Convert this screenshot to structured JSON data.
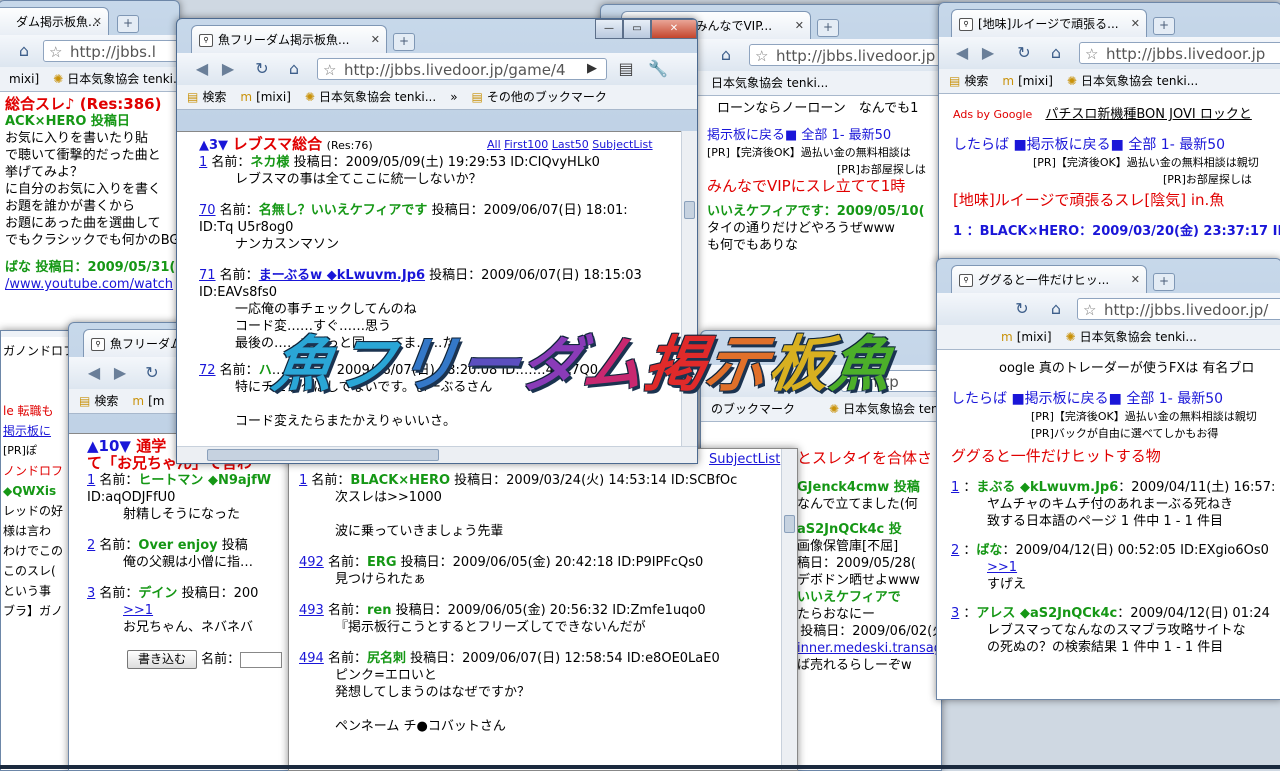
{
  "desktop": {
    "logo_text": "魚フリーダム掲示板魚"
  },
  "win_a": {
    "tab_title": "ダム掲示板魚...",
    "url": "http://jbbs.l",
    "bookmarks": [
      "mixi]",
      "日本気象協会 tenki..."
    ],
    "lines": [
      "総合スレ♪ (Res:386)",
      "ACK×HERO 投稿日",
      "お気に入りを書いたり貼",
      "で聴いて衝撃的だった曲と",
      "挙げてみよ？",
      "に自分のお気に入りを書く",
      "お題を誰かが書くから",
      "お題にあった曲を選曲して",
      "でもクラシックでも何かのBG",
      "ばな 投稿日：2009/05/31(",
      "/www.youtube.com/watch"
    ]
  },
  "win_b": {
    "tab_title": "魚フリーダム掲示板魚...",
    "url": "http://jbbs.livedoor.jp/game/4",
    "bookmarks": [
      "検索",
      "[mixi]",
      "日本気象協会 tenki..."
    ],
    "other_bookmarks": "その他のブックマーク",
    "thread_num": "▲3▼",
    "thread_title": "レブスマ総合",
    "res": "(Res:76)",
    "nav": [
      "All",
      "First100",
      "Last50",
      "SubjectList"
    ],
    "posts": [
      {
        "no": "1",
        "label": " 名前：",
        "name": "ネカ様",
        "meta": " 投稿日：2009/05/09(土) 19:29:53 ID:CIQvyHLk0",
        "body": [
          "レブスマの事は全てここに統一しないか？"
        ]
      },
      {
        "no": "70",
        "label": " 名前：",
        "name": "名無し？いいえケフィアです",
        "meta": " 投稿日：2009/06/07(日) 18:01:",
        "body": [
          "ID:Tq U5r8og0",
          "ナンカスンマソン"
        ]
      },
      {
        "no": "71",
        "label": " 名前：",
        "name": "まーぶるw ◆kLwuvm.Jp6",
        "meta": " 投稿日：2009/06/07(日) 18:15:03",
        "body": [
          "ID:EAVs8fs0",
          "一応俺の事チェックしてんのね",
          "コード変……すぐ……思う",
          "最後の……ちょっと同……てま……た"
        ]
      },
      {
        "no": "72",
        "label": " 名前：",
        "name": "ハ",
        "meta": "……稿日：2009/06/07(日) 18:20:08 ID:……44C7Q0",
        "body": [
          "特にチェックはしてないです。まーぶるさん",
          "",
          "コード変えたらまたかえりゃいいさ。"
        ]
      }
    ]
  },
  "win_c": {
    "tab_title": "掲示板...みんなでVIP...",
    "url": "http://jbbs.livedoor.jp",
    "bookmarks": [
      "ローンならノーローン",
      "なんでも1"
    ],
    "lines": [
      "掲示板に戻る■ 全部 1- 最新50",
      "[PR]【完済後OK】過払い金の無料相談は",
      "[PR]お部屋探しは",
      "みんなでVIPにスレ立てて1時",
      "",
      "いいえケフィアです：2009/05/10(",
      "タイの通りだけどやろうぜwww",
      "も何でもありな"
    ]
  },
  "win_d": {
    "tab_title": "[地味]ルイージで頑張る...",
    "url": "http://jbbs.livedoor.jp",
    "bookmarks": [
      "検索",
      "[mixi]",
      "日本気象協会 tenki..."
    ],
    "ads_label": "Ads by Google",
    "ads": "パチスロ新機種BON JOVI ロックと",
    "nav": "したらば ■掲示板に戻る■ 全部 1- 最新50",
    "pr1": "[PR]【完済後OK】過払い金の無料相談は親切",
    "pr2": "[PR]お部屋探しは",
    "thread_title": "[地味]ルイージで頑張るスレ[陰気] in.魚",
    "post1": "1 ：BLACK×HERO：2009/03/20(金) 23:37:17 ID"
  },
  "win_e": {
    "tab_title": "ググると一件だけヒッ...",
    "url": "http://jbbs.livedoor.jp/",
    "bookmarks": [
      "[mixi]",
      "日本気象協会 tenki..."
    ],
    "ads": "oogle 真のトレーダーが使うFXは 有名ブロ",
    "nav": "したらば ■掲示板に戻る■ 全部 1- 最新50",
    "pr1": "[PR]【完済後OK】過払い金の無料相談は親切",
    "pr2": "[PR]バックが自由に選べてしかもお得",
    "thread_title": "ググると一件だけヒットする物",
    "posts": [
      {
        "no": "1",
        "name": "まぶる ◆kLwuvm.Jp6",
        "meta": "：2009/04/11(土) 16:57:",
        "body": [
          "ヤムチャのキムチ付のあれまーぶる死ねき",
          "致する日本語のページ 1 件中 1 - 1 件目"
        ]
      },
      {
        "no": "2",
        "name": "ばな",
        "meta": "：2009/04/12(日) 00:52:05 ID:EXgio6Os0",
        "body": [
          ">>1",
          "すげえ"
        ]
      },
      {
        "no": "3",
        "name": "アレス ◆aS2JnQCk4c",
        "meta": "：2009/04/12(日) 01:24",
        "body": [
          "レブスマってなんなのスマブラ攻略サイトな",
          "の死ぬの？の検索結果 1 件中 1 - 1 件目"
        ]
      }
    ]
  },
  "win_f": {
    "tab_title": "魚フリーダム",
    "bookmarks": [
      "検索",
      "[m"
    ],
    "thread_num": "▲10▼",
    "thread_title": "通学",
    "thread_title2": "て「お兄ちゃん」て言わ",
    "posts": [
      {
        "no": "1",
        "name": "ヒートマン ◆N9ajfW",
        "body": [
          "ID:aqODJFfU0",
          "射精しそうになった"
        ]
      },
      {
        "no": "2",
        "name": "Over enjoy",
        "meta": " 投稿",
        "body": [
          "俺の父親は小僧に指…"
        ]
      },
      {
        "no": "3",
        "name": "デイン",
        "meta": " 投稿日：200",
        "body": [
          ">>1",
          "お兄ちゃん、ネバネバ"
        ]
      }
    ],
    "write_button": "書き込む",
    "name_label": "名前："
  },
  "win_g": {
    "nav": "SubjectList",
    "posts": [
      {
        "no": "1",
        "name": "BLACK×HERO",
        "meta": " 投稿日：2009/03/24(火) 14:53:14 ID:SCBfOc",
        "body": [
          "次スレは>>1000",
          "",
          "波に乗っていきましょう先輩"
        ]
      },
      {
        "no": "492",
        "name": "ERG",
        "meta": " 投稿日：2009/06/05(金) 20:42:18 ID:P9IPFcQs0",
        "body": [
          "見つけられたぁ"
        ]
      },
      {
        "no": "493",
        "name": "ren",
        "meta": " 投稿日：2009/06/05(金) 20:56:32 ID:Zmfe1uqo0",
        "body": [
          "『掲示板行こうとするとフリーズしてできないんだが"
        ]
      },
      {
        "no": "494",
        "name": "尻名刺",
        "meta": " 投稿日：2009/06/07(日) 12:58:54 ID:e8OE0LaE0",
        "body": [
          "ピンク=エロいと",
          "発想してしまうのはなぜですか？",
          "",
          "ペンネーム チ●コバットさん"
        ]
      }
    ]
  },
  "win_h": {
    "bookmarks": [
      "のブックマーク",
      "日本気象協会 tenki..."
    ],
    "lines": [
      "とスレタイを合体さ",
      "GJenck4cmw 投稿",
      "なんで立てました(何",
      "aS2JnQCk4c 投",
      "画像保管庫[不屈]",
      "稿日：2009/05/28(",
      "デボドン晒せよwww",
      "",
      "いいえケフィアで",
      "たらおなにー",
      "] 投稿日：2009/06/02(火) 20:47:33 ID:uAOV1Dy80",
      "inner.medeski.transagtion.com/",
      "ば売れるらしーぞw"
    ]
  },
  "win_i": {
    "lines": [
      "ガノンドロフ",
      "",
      "le 転職も",
      "掲示板に",
      "[PR]ぽ",
      "ノンドロフ",
      "",
      "◆QWXis",
      "レッドの好",
      "様は言わ",
      "わけでこの",
      "このスレ(",
      "という事",
      "",
      "ブラ】ガノ"
    ]
  }
}
